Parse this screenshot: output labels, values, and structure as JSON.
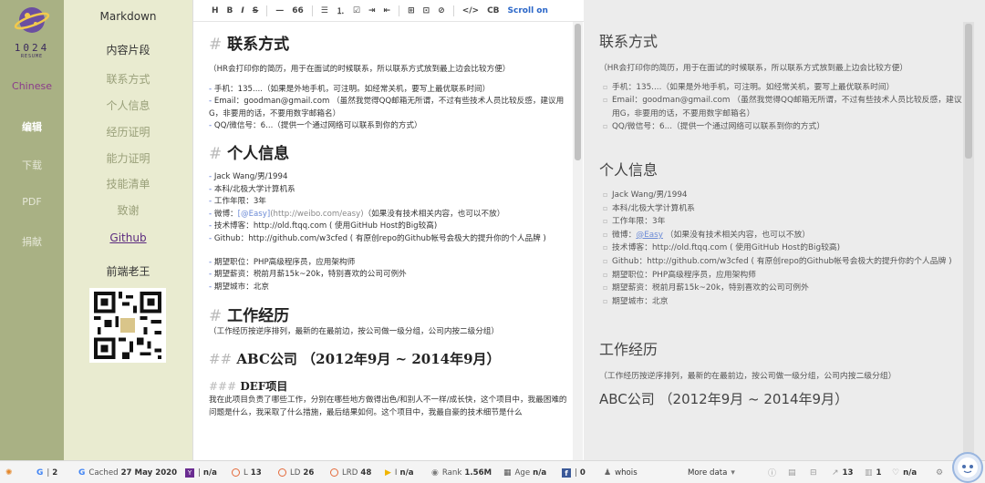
{
  "logo": {
    "brand": "1024",
    "sub": "RESUME",
    "icon": "planet-logo-icon"
  },
  "leftnav": {
    "lang": "Chinese",
    "items": [
      "编辑",
      "下载",
      "PDF",
      "捐献"
    ]
  },
  "subnav": {
    "markdown": "Markdown",
    "snippets": "内容片段",
    "items": [
      "联系方式",
      "个人信息",
      "经历证明",
      "能力证明",
      "技能清单",
      "致谢"
    ],
    "github": "Github",
    "author": "前端老王"
  },
  "toolbar": {
    "buttons": [
      "H",
      "B",
      "I",
      "S",
      "—",
      "66",
      "☰",
      "⒈",
      "☑",
      "⇥",
      "⇤",
      "⊞",
      "⊡",
      "⊘",
      "</>",
      "CB"
    ],
    "scroll_label": "Scroll on"
  },
  "editor": {
    "contact_heading": "联系方式",
    "contact_note": "（HR会打印你的简历，用于在面试的时候联系，所以联系方式放到最上边会比较方便）",
    "contact_items": [
      "手机：135....（如果是外地手机，可注明。如经常关机，要写上最优联系时间）",
      "Email：goodman@gmail.com （虽然我觉得QQ邮箱无所谓，不过有些技术人员比较反感，建议用G，非要用的话，不要用数字邮箱名）",
      "QQ/微信号：6...（提供一个通过网络可以联系到你的方式）"
    ],
    "info_heading": "个人信息",
    "info_items": [
      "Jack Wang/男/1994",
      "本科/北极大学计算机系",
      "工作年限：3年"
    ],
    "weibo_prefix": "微博：",
    "weibo_link": "[@Easy]",
    "weibo_url": "(http://weibo.com/easy)",
    "weibo_note": "（如果没有技术相关内容，也可以不放）",
    "info_items2": [
      "技术博客：http://old.ftqq.com ( 使用GitHub Host的Big较高)",
      "Github：http://github.com/w3cfed ( 有原创repo的Github帐号会极大的提升你的个人品牌 )"
    ],
    "job_items": [
      "期望职位：PHP高级程序员，应用架构师",
      "期望薪资：税前月薪15k~20k，特别喜欢的公司可例外",
      "期望城市：北京"
    ],
    "work_heading": "工作经历",
    "work_note": "（工作经历按逆序排列，最新的在最前边，按公司做一级分组，公司内按二级分组）",
    "company_heading": "ABC公司 （2012年9月 ~ 2014年9月）",
    "project_heading": "DEF项目",
    "project_text": "我在此项目负责了哪些工作，分别在哪些地方做得出色/和别人不一样/成长快，这个项目中，我最困难的问题是什么，我采取了什么措施，最后结果如何。这个项目中，我最自豪的技术细节是什么"
  },
  "preview": {
    "contact_heading": "联系方式",
    "contact_note": "（HR会打印你的简历，用于在面试的时候联系，所以联系方式放到最上边会比较方便）",
    "contact_items": [
      "手机：135....（如果是外地手机，可注明。如经常关机，要写上最优联系时间）",
      "Email：goodman@gmail.com （虽然我觉得QQ邮箱无所谓，不过有些技术人员比较反感，建议用G，非要用的话，不要用数字邮箱名）",
      "QQ/微信号：6...（提供一个通过网络可以联系到你的方式）"
    ],
    "info_heading": "个人信息",
    "info_items": [
      "Jack Wang/男/1994",
      "本科/北极大学计算机系",
      "工作年限：3年"
    ],
    "weibo_prefix": "微博：",
    "weibo_link": "@Easy",
    "weibo_note": " （如果没有技术相关内容，也可以不放）",
    "info_items2": [
      "技术博客：http://old.ftqq.com ( 使用GitHub Host的Big较高)",
      "Github：http://github.com/w3cfed ( 有原创repo的Github帐号会极大的提升你的个人品牌 )",
      "期望职位：PHP高级程序员，应用架构师",
      "期望薪资：税前月薪15k~20k，特别喜欢的公司可例外",
      "期望城市：北京"
    ],
    "work_heading": "工作经历",
    "work_note": "（工作经历按逆序排列，最新的在最前边，按公司做一级分组，公司内按二级分组）",
    "company_heading": "ABC公司 （2012年9月 ~ 2014年9月）"
  },
  "statusbar": {
    "g_label": "G",
    "g_value": "2",
    "cached_label": "Cached",
    "cached_value": "27 May 2020",
    "y_value": "n/a",
    "l_label": "L",
    "l_value": "13",
    "ld_label": "LD",
    "ld_value": "26",
    "lrd_label": "LRD",
    "lrd_value": "48",
    "i_value": "n/a",
    "rank_label": "Rank",
    "rank_value": "1.56M",
    "age_label": "Age",
    "age_value": "n/a",
    "fb_value": "0",
    "whois": "whois",
    "more": "More data",
    "links_value": "13",
    "pages_value": "1",
    "v_value": "n/a"
  },
  "colors": {
    "leftnav_bg": "#a9b184",
    "subnav_bg": "#e9ebd0",
    "accent_purple": "#5b2a7f",
    "link_blue": "#2a66c8"
  }
}
